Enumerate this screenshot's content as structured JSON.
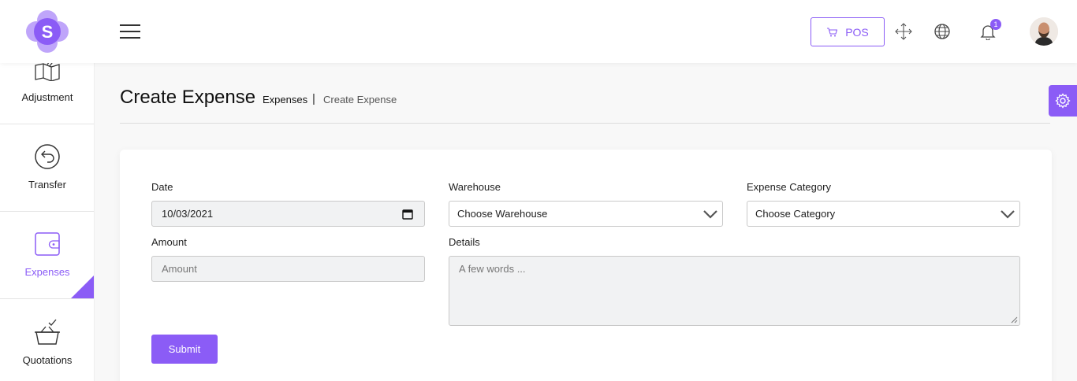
{
  "colors": {
    "accent": "#8b5cf6",
    "text": "#222222"
  },
  "brand": {
    "logo_letter": "S"
  },
  "header": {
    "pos_label": "POS",
    "notification_count": "1",
    "icons": [
      "menu-icon",
      "cart-icon",
      "fullscreen-icon",
      "globe-icon",
      "bell-icon"
    ]
  },
  "sidebar": {
    "items": [
      {
        "label": "Adjustment",
        "icon": "adjustment-icon",
        "active": false
      },
      {
        "label": "Transfer",
        "icon": "transfer-icon",
        "active": false
      },
      {
        "label": "Expenses",
        "icon": "wallet-icon",
        "active": true
      },
      {
        "label": "Quotations",
        "icon": "basket-icon",
        "active": false
      }
    ]
  },
  "page": {
    "title": "Create Expense",
    "breadcrumb": [
      "Expenses",
      "Create Expense"
    ],
    "breadcrumb_separator": "|"
  },
  "form": {
    "date": {
      "label": "Date",
      "value": "10/03/2021"
    },
    "warehouse": {
      "label": "Warehouse",
      "selected": "Choose Warehouse"
    },
    "category": {
      "label": "Expense Category",
      "selected": "Choose Category"
    },
    "amount": {
      "label": "Amount",
      "placeholder": "Amount"
    },
    "details": {
      "label": "Details",
      "placeholder": "A few words ..."
    },
    "submit_label": "Submit"
  }
}
